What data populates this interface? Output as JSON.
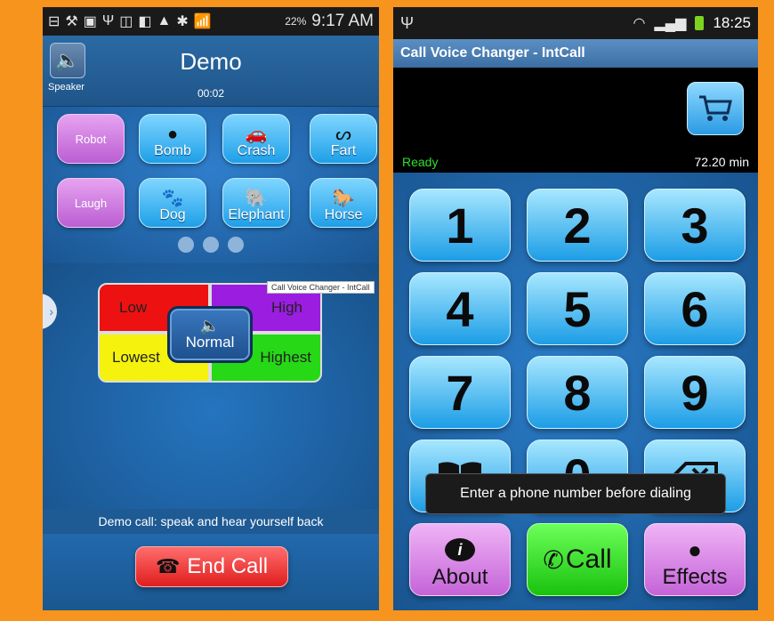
{
  "left": {
    "status": {
      "icons": [
        "⊟",
        "⚒",
        "▣",
        "Ψ",
        "◫",
        "◧",
        "▲",
        "✱",
        "📶"
      ],
      "battery": "22%",
      "time": "9:17 AM"
    },
    "header": {
      "speaker_label": "Speaker",
      "title": "Demo",
      "timer": "00:02"
    },
    "effects": {
      "robot": "Robot",
      "bomb": "Bomb",
      "crash": "Crash",
      "fart": "Fart",
      "laugh": "Laugh",
      "dog": "Dog",
      "elephant": "Elephant",
      "horse": "Horse"
    },
    "tooltip": "Call Voice Changer - IntCall",
    "pitch": {
      "low": "Low",
      "high": "High",
      "normal": "Normal",
      "lowest": "Lowest",
      "highest": "Highest"
    },
    "demo_note": "Demo call: speak and hear yourself back",
    "end_call": "End Call"
  },
  "right": {
    "status": {
      "time": "18:25"
    },
    "app_title": "Call Voice Changer - IntCall",
    "display": {
      "status": "Ready",
      "minutes": "72.20 min"
    },
    "keys": [
      "1",
      "2",
      "3",
      "4",
      "5",
      "6",
      "7",
      "8",
      "9",
      "0"
    ],
    "toast": "Enter a phone number before dialing",
    "buttons": {
      "about": "About",
      "call": "Call",
      "effects": "Effects"
    }
  }
}
